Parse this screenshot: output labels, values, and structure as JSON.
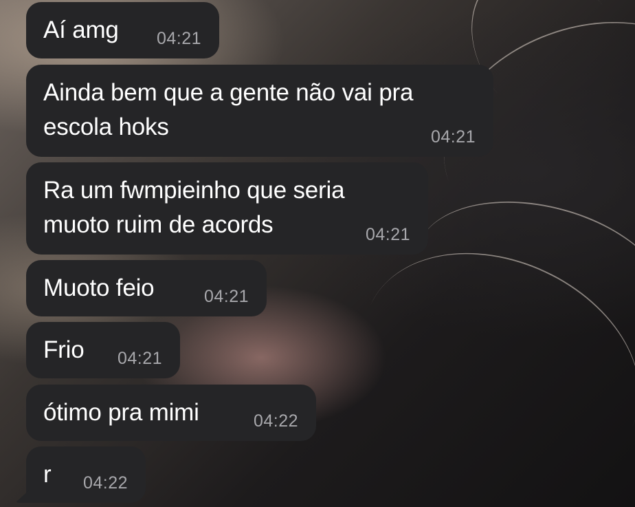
{
  "messages": [
    {
      "text": "Aí amg",
      "time": "04:21"
    },
    {
      "text": "Ainda bem que a gente não vai pra\nescola hoks",
      "time": "04:21"
    },
    {
      "text": "Ra um fwmpieinho que seria\nmuoto ruim de acords",
      "time": "04:21"
    },
    {
      "text": "Muoto feio",
      "time": "04:21"
    },
    {
      "text": "Frio",
      "time": "04:21"
    },
    {
      "text": "ótimo pra mimi",
      "time": "04:22"
    },
    {
      "text": "r",
      "time": "04:22"
    }
  ],
  "colors": {
    "bubble": "#252527",
    "text": "#ffffff",
    "time": "#a8a8ac"
  }
}
